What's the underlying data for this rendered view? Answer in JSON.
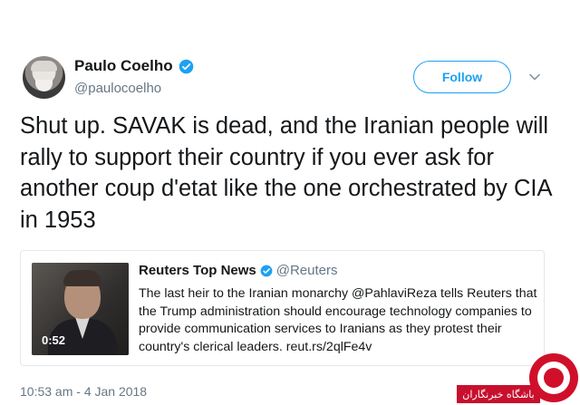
{
  "author": {
    "display_name": "Paulo Coelho",
    "handle": "@paulocoelho",
    "avatar_icon": "profile-photo",
    "verified_icon": "verified-badge-icon"
  },
  "follow_button": {
    "label": "Follow"
  },
  "menu_caret_icon": "chevron-down-icon",
  "tweet": {
    "text": "Shut up. SAVAK is dead, and the Iranian people will rally to support their country if you ever ask for another coup d'etat like the one orchestrated by CIA in 1953",
    "timestamp": "10:53 am - 4 Jan 2018"
  },
  "quoted_tweet": {
    "author_name": "Reuters Top News",
    "author_handle": "@Reuters",
    "video_duration": "0:52",
    "text": "The last heir to the Iranian monarchy @PahlaviReza tells Reuters that the Trump administration should encourage technology companies to provide communication services to Iranians as they protest their country's clerical leaders. reut.rs/2qlFe4v"
  },
  "watermark": {
    "label": "باشگاه خبرنگاران"
  },
  "colors": {
    "accent": "#1da1f2",
    "secondary_text": "#657786",
    "watermark_red": "#c8102e"
  }
}
